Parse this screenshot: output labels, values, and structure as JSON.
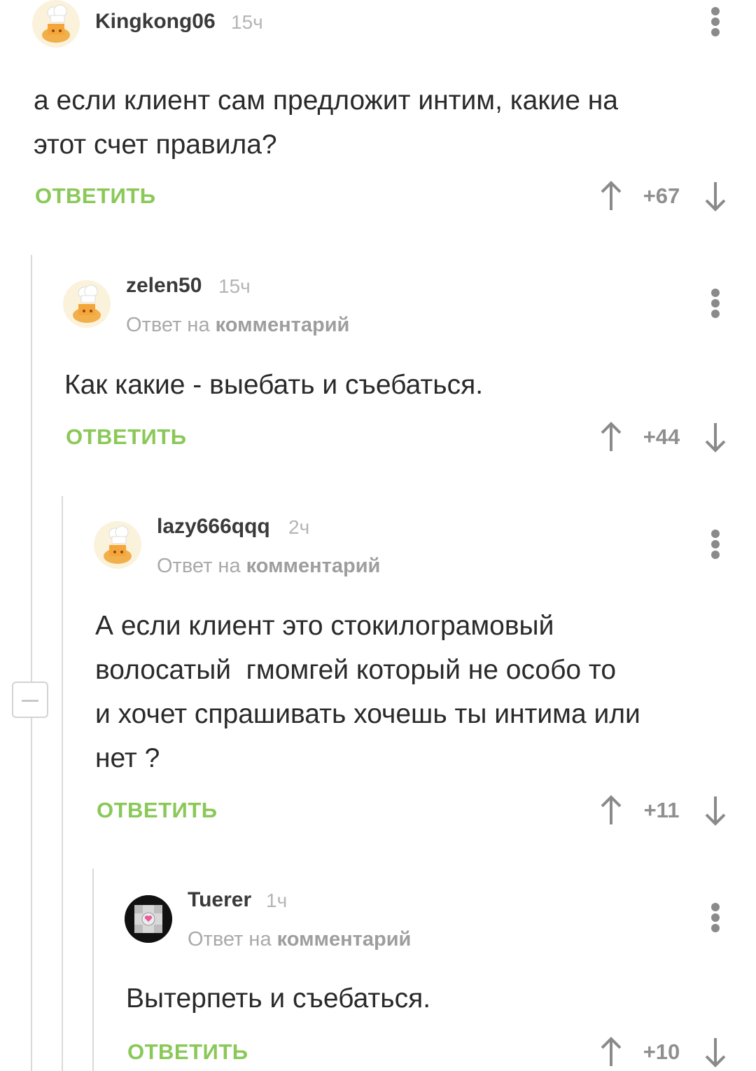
{
  "reply_label": "ОТВЕТИТЬ",
  "reply_to_prefix": "Ответ на",
  "reply_to_link": "комментарий",
  "colors": {
    "accent_green": "#8ac858",
    "thread_line": "#d9d9d9",
    "meta_gray": "#b5b5b5"
  },
  "comments": [
    {
      "username": "Kingkong06",
      "time": "15ч",
      "text_lines": [
        "а если клиент сам предложит интим, какие на",
        "этот счет правила?"
      ],
      "score": "+67",
      "avatar_icon": "cook-hat-avatar-icon"
    },
    {
      "username": "zelen50",
      "time": "15ч",
      "text_lines": [
        "Как какие - выебать и съебаться."
      ],
      "score": "+44",
      "avatar_icon": "cook-hat-avatar-icon"
    },
    {
      "username": "lazy666qqq",
      "time": "2ч",
      "text_lines": [
        "А если клиент это стокилограмовый",
        "волосатый  гмомгей который не особо то",
        "и хочет спрашивать хочешь ты интима или",
        "нет ?"
      ],
      "score": "+11",
      "avatar_icon": "cook-hat-avatar-icon"
    },
    {
      "username": "Tuerer",
      "time": "1ч",
      "text_lines": [
        "Вытерпеть и съебаться."
      ],
      "score": "+10",
      "avatar_icon": "companion-cube-avatar-icon"
    }
  ]
}
